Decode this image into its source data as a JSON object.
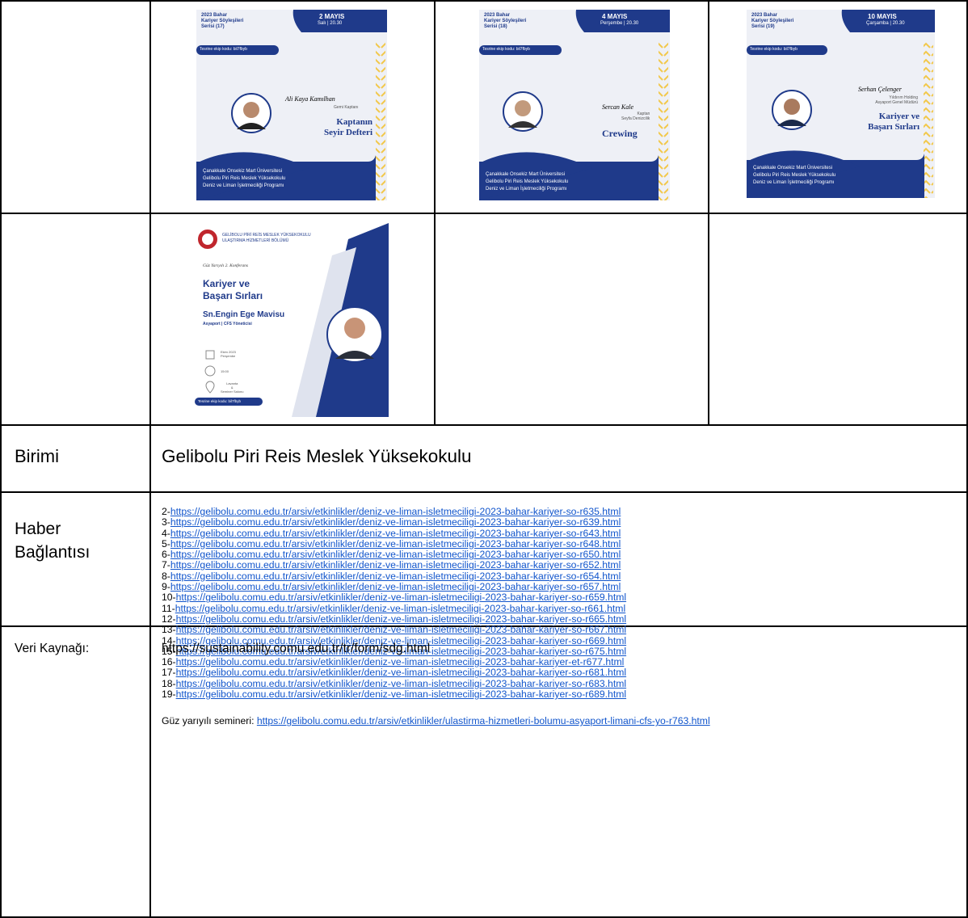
{
  "posters": [
    {
      "series": "2023 Bahar\nKariyer Söyleşileri\nSerisi (17)",
      "date": "2 MAYIS",
      "day_time": "Salı | 20.30",
      "code": "Tesrine ekip kodu: bil7fbyb",
      "speaker": "Ali Kaya Kamılhan",
      "role": "Gemi Kaptanı",
      "topic": "Kaptanın\nSeyir Defteri",
      "footer": "Çanakkale Onsekiz Mart Üniversitesi\nGelibolu Piri Reis Meslek Yüksekokulu\nDeniz ve Liman İşletmeciliği Programı"
    },
    {
      "series": "2023 Bahar\nKariyer Söyleşileri\nSerisi (18)",
      "date": "4 MAYIS",
      "day_time": "Perşembe | 20.30",
      "code": "Tesrine ekip kodu: bil7fbyb",
      "speaker": "Sercan Kale",
      "role": "Kaptan\nSeyfa Denizcilik",
      "topic": "Crewing",
      "footer": "Çanakkale Onsekiz Mart Üniversitesi\nGelibolu Piri Reis Meslek Yüksekokulu\nDeniz ve Liman İşletmeciliği Programı"
    },
    {
      "series": "2023 Bahar\nKariyer Söyleşileri\nSerisi (19)",
      "date": "10 MAYIS",
      "day_time": "Çarşamba | 20.30",
      "code": "Tesrine ekip kodu: bil7fbyb",
      "speaker": "Serhan Çelenger",
      "role": "Yıldırım Holding\nAsyaport Genel Müdürü",
      "topic": "Kariyer ve\nBaşarı Sırları",
      "footer": "Çanakkale Onsekiz Mart Üniversitesi\nGelibolu Piri Reis Meslek Yüksekokulu\nDeniz ve Liman İşletmeciliği Programı"
    }
  ],
  "poster4": {
    "header": "GELİBOLU PİRİ REİS MESLEK YÜKSEKOKULU\nULAŞTIRMA HİZMETLERİ BÖLÜMÜ",
    "subtitle": "Güz Yarıyılı 2. Konferans",
    "title": "Kariyer ve\nBaşarı Sırları",
    "speaker": "Sn.Engin Ege Mavisu",
    "role": "Asyaport | CFS Yöneticisi",
    "date": "Ekim 2023\nPerşembe",
    "time": "15:00",
    "place": "Lavanta\n&\nSeminer Salonu",
    "code": "Tesrine ekip kodu: bil7fbyb"
  },
  "rows": {
    "birimi_label": "Birimi",
    "birimi_value": "Gelibolu Piri Reis Meslek Yüksekokulu",
    "haber_label": "Haber\nBağlantısı",
    "links": [
      {
        "prefix": "2-",
        "url": "https://gelibolu.comu.edu.tr/arsiv/etkinlikler/deniz-ve-liman-isletmeciligi-2023-bahar-kariyer-so-r635.html"
      },
      {
        "prefix": "3-",
        "url": "https://gelibolu.comu.edu.tr/arsiv/etkinlikler/deniz-ve-liman-isletmeciligi-2023-bahar-kariyer-so-r639.html"
      },
      {
        "prefix": "4-",
        "url": "https://gelibolu.comu.edu.tr/arsiv/etkinlikler/deniz-ve-liman-isletmeciligi-2023-bahar-kariyer-so-r643.html"
      },
      {
        "prefix": "5-",
        "url": "https://gelibolu.comu.edu.tr/arsiv/etkinlikler/deniz-ve-liman-isletmeciligi-2023-bahar-kariyer-so-r648.html"
      },
      {
        "prefix": "6-",
        "url": "https://gelibolu.comu.edu.tr/arsiv/etkinlikler/deniz-ve-liman-isletmeciligi-2023-bahar-kariyer-so-r650.html"
      },
      {
        "prefix": "7-",
        "url": "https://gelibolu.comu.edu.tr/arsiv/etkinlikler/deniz-ve-liman-isletmeciligi-2023-bahar-kariyer-so-r652.html"
      },
      {
        "prefix": "8-",
        "url": "https://gelibolu.comu.edu.tr/arsiv/etkinlikler/deniz-ve-liman-isletmeciligi-2023-bahar-kariyer-so-r654.html"
      },
      {
        "prefix": "9-",
        "url": "https://gelibolu.comu.edu.tr/arsiv/etkinlikler/deniz-ve-liman-isletmeciligi-2023-bahar-kariyer-so-r657.html"
      },
      {
        "prefix": "10-",
        "url": "https://gelibolu.comu.edu.tr/arsiv/etkinlikler/deniz-ve-liman-isletmeciligi-2023-bahar-kariyer-so-r659.html"
      },
      {
        "prefix": "11-",
        "url": "https://gelibolu.comu.edu.tr/arsiv/etkinlikler/deniz-ve-liman-isletmeciligi-2023-bahar-kariyer-so-r661.html"
      },
      {
        "prefix": "12-",
        "url": "https://gelibolu.comu.edu.tr/arsiv/etkinlikler/deniz-ve-liman-isletmeciligi-2023-bahar-kariyer-so-r665.html"
      },
      {
        "prefix": "13-",
        "url": "https://gelibolu.comu.edu.tr/arsiv/etkinlikler/deniz-ve-liman-isletmeciligi-2023-bahar-kariyer-so-r667.html"
      },
      {
        "prefix": "14-",
        "url": "https://gelibolu.comu.edu.tr/arsiv/etkinlikler/deniz-ve-liman-isletmeciligi-2023-bahar-kariyer-so-r669.html"
      },
      {
        "prefix": "15-",
        "url": "https://gelibolu.comu.edu.tr/arsiv/etkinlikler/deniz-ve-liman-isletmeciligi-2023-bahar-kariyer-so-r675.html"
      },
      {
        "prefix": "16-",
        "url": "https://gelibolu.comu.edu.tr/arsiv/etkinlikler/deniz-ve-liman-isletmeciligi-2023-bahar-kariyer-et-r677.html"
      },
      {
        "prefix": "17-",
        "url": "https://gelibolu.comu.edu.tr/arsiv/etkinlikler/deniz-ve-liman-isletmeciligi-2023-bahar-kariyer-so-r681.html"
      },
      {
        "prefix": "18-",
        "url": "https://gelibolu.comu.edu.tr/arsiv/etkinlikler/deniz-ve-liman-isletmeciligi-2023-bahar-kariyer-so-r683.html"
      },
      {
        "prefix": "19-",
        "url": "https://gelibolu.comu.edu.tr/arsiv/etkinlikler/deniz-ve-liman-isletmeciligi-2023-bahar-kariyer-so-r689.html"
      }
    ],
    "guz_prefix": "Güz yarıyılı semineri: ",
    "guz_url": "https://gelibolu.comu.edu.tr/arsiv/etkinlikler/ulastirma-hizmetleri-bolumu-asyaport-limani-cfs-yo-r763.html",
    "veri_label": "Veri Kaynağı:",
    "veri_value": "https://sustainability.comu.edu.tr/tr/form/sdg.html"
  },
  "colors": {
    "navy": "#1f3a8a",
    "poster_bg": "#eef0f6",
    "chevron": "#f2c84b",
    "link": "#1155cc"
  }
}
